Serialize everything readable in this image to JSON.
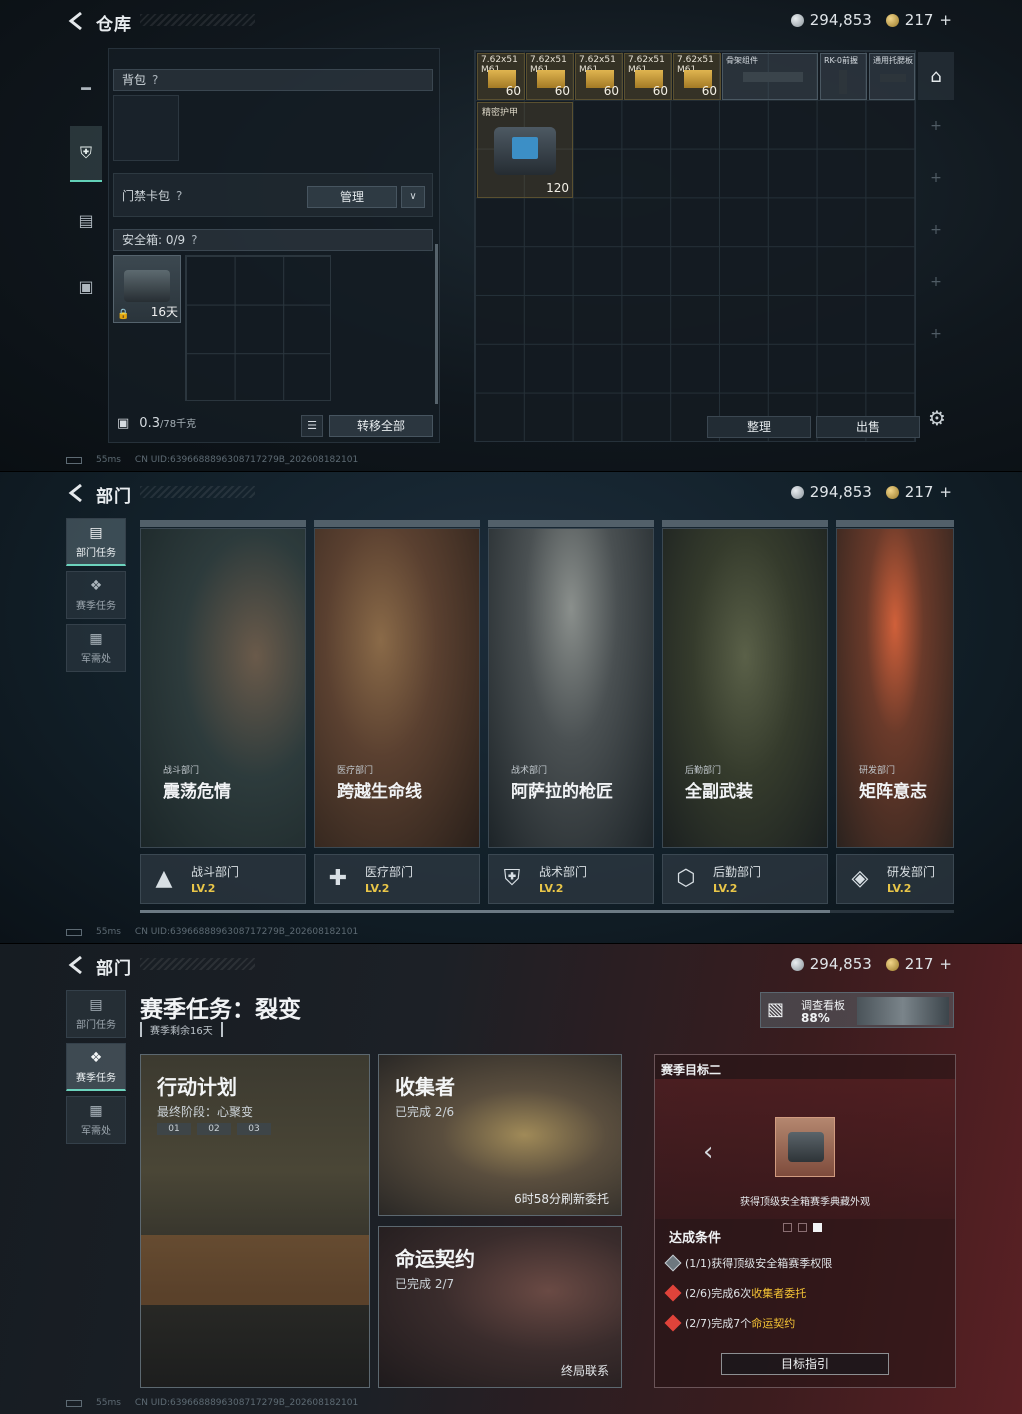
{
  "currency": {
    "silver": "294,853",
    "gold": "217"
  },
  "footer": {
    "ping": "55ms",
    "uid": "CN UID:6396688896308717279B_202608182101"
  },
  "warehouse": {
    "title": "仓库",
    "backpack": "背包",
    "keycard": "门禁卡包",
    "manage": "管理",
    "safe_box": "安全箱: 0/9",
    "safe_time": "16天",
    "weight_main": "0.3",
    "weight_unit": "/78千克",
    "transfer_all": "转移全部",
    "sort": "整理",
    "sell": "出售",
    "ammo": [
      {
        "name": "7.62x51\nM61",
        "count": "60"
      },
      {
        "name": "7.62x51\nM61",
        "count": "60"
      },
      {
        "name": "7.62x51\nM61",
        "count": "60"
      },
      {
        "name": "7.62x51\nM61",
        "count": "60"
      },
      {
        "name": "7.62x51\nM61",
        "count": "60"
      }
    ],
    "parts": [
      "骨架组件",
      "RK-0前握",
      "通用托腮板"
    ],
    "armor_name": "精密护甲",
    "armor_value": "120",
    "qmark": "?"
  },
  "departments": {
    "title": "部门",
    "tabs": [
      "部门任务",
      "赛季任务",
      "军需处"
    ],
    "cards": [
      {
        "category": "战斗部门",
        "name": "震荡危情",
        "dept": "战斗部门",
        "level": "LV.2",
        "icon": "assault-icon"
      },
      {
        "category": "医疗部门",
        "name": "跨越生命线",
        "dept": "医疗部门",
        "level": "LV.2",
        "icon": "medical-icon"
      },
      {
        "category": "战术部门",
        "name": "阿萨拉的枪匠",
        "dept": "战术部门",
        "level": "LV.2",
        "icon": "tactical-icon"
      },
      {
        "category": "后勤部门",
        "name": "全副武装",
        "dept": "后勤部门",
        "level": "LV.2",
        "icon": "logistics-icon"
      },
      {
        "category": "研发部门",
        "name": "矩阵意志",
        "dept": "研发部门",
        "level": "LV.2",
        "icon": "research-icon"
      }
    ]
  },
  "season": {
    "title": "部门",
    "heading": "赛季任务：裂变",
    "remaining": "赛季剩余16天",
    "survey_label": "调查看板",
    "survey_pct": "88%",
    "missions": {
      "action": {
        "title": "行动计划",
        "sub": "最终阶段：心聚变",
        "stages": [
          "01",
          "02",
          "03"
        ]
      },
      "collector": {
        "title": "收集者",
        "sub": "已完成 2/6",
        "note": "6时58分刷新委托"
      },
      "fate": {
        "title": "命运契约",
        "sub": "已完成 2/7",
        "note": "终局联系"
      }
    },
    "goal": {
      "head": "赛季目标二",
      "desc": "获得顶级安全箱赛季典藏外观",
      "cond_title": "达成条件",
      "conds": [
        {
          "pre": "(1/1)获得顶级安全箱赛季权限",
          "hl": "",
          "post": ""
        },
        {
          "pre": "(2/6)完成6次",
          "hl": "收集者委托",
          "post": ""
        },
        {
          "pre": "(2/7)完成7个",
          "hl": "命运契约",
          "post": ""
        }
      ],
      "guide": "目标指引"
    }
  }
}
